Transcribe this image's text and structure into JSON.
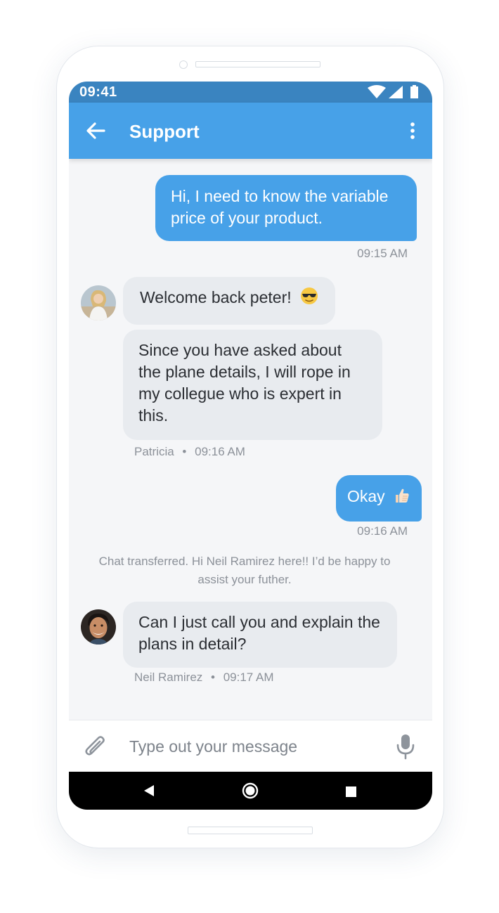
{
  "status_bar": {
    "time": "09:41"
  },
  "app_bar": {
    "title": "Support",
    "back_icon": "arrow-left-icon",
    "menu_icon": "more-vertical-icon"
  },
  "messages": [
    {
      "direction": "outgoing",
      "text": "Hi, I need to know the variable price of your product.",
      "time": "09:15 AM"
    },
    {
      "direction": "incoming",
      "text": "Welcome back peter!",
      "emoji": "sunglasses-emoji"
    },
    {
      "direction": "incoming",
      "text": "Since you have asked about the plane details, I will rope in my collegue who is expert in this.",
      "sender": "Patricia",
      "separator": "•",
      "time": "09:16 AM"
    },
    {
      "direction": "outgoing",
      "text": "Okay",
      "emoji": "thumbs-up-emoji",
      "time": "09:16 AM"
    },
    {
      "direction": "incoming",
      "text": "Can I just call you and explain the plans in detail?",
      "sender": "Neil Ramirez",
      "separator": "•",
      "time": "09:17 AM"
    }
  ],
  "system_message": "Chat transferred. Hi Neil Ramirez here!! I’d be happy to assist your futher.",
  "composer": {
    "placeholder": "Type out your message",
    "attach_icon": "paperclip-icon",
    "mic_icon": "microphone-icon"
  },
  "colors": {
    "primary": "#47a1e8",
    "status_bar": "#3a84c0",
    "incoming_bubble": "#e8ebef",
    "meta_text": "#8c9199"
  }
}
